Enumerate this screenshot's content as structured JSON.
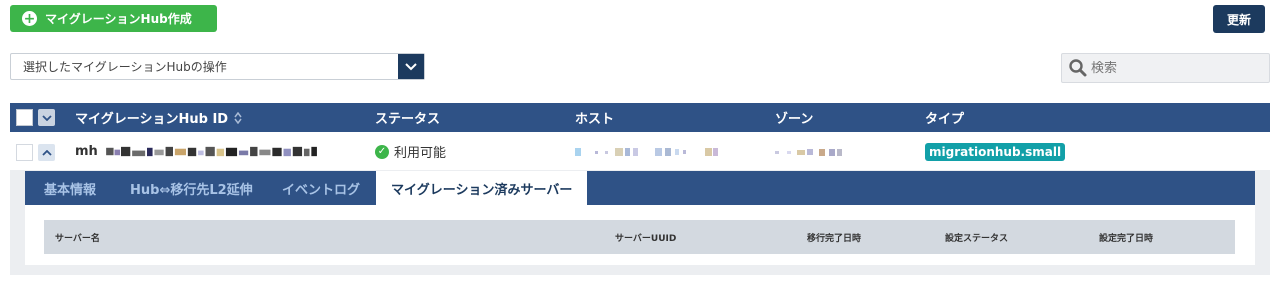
{
  "toolbar": {
    "create_label": "マイグレーションHub作成",
    "refresh_label": "更新"
  },
  "bulk_action": {
    "placeholder": "選択したマイグレーションHubの操作"
  },
  "search": {
    "placeholder": "検索"
  },
  "table": {
    "columns": {
      "id": "マイグレーションHub ID",
      "status": "ステータス",
      "host": "ホスト",
      "zone": "ゾーン",
      "type": "タイプ"
    },
    "rows": [
      {
        "id_prefix": "mh",
        "status": "利用可能",
        "type": "migrationhub.small"
      }
    ]
  },
  "detail": {
    "tabs": [
      {
        "label": "基本情報"
      },
      {
        "label": "Hub⇔移行先L2延伸"
      },
      {
        "label": "イベントログ"
      },
      {
        "label": "マイグレーション済みサーバー"
      }
    ],
    "active_tab": "マイグレーション済みサーバー",
    "server_table": {
      "columns": {
        "name": "サーバー名",
        "uuid": "サーバーUUID",
        "migrated_at": "移行完了日時",
        "config_status": "設定ステータス",
        "configured_at": "設定完了日時"
      }
    }
  },
  "colors": {
    "primary_green": "#3db54a",
    "navy": "#1c3a5e",
    "header_blue": "#2f5286",
    "teal_badge": "#12a0a8"
  }
}
